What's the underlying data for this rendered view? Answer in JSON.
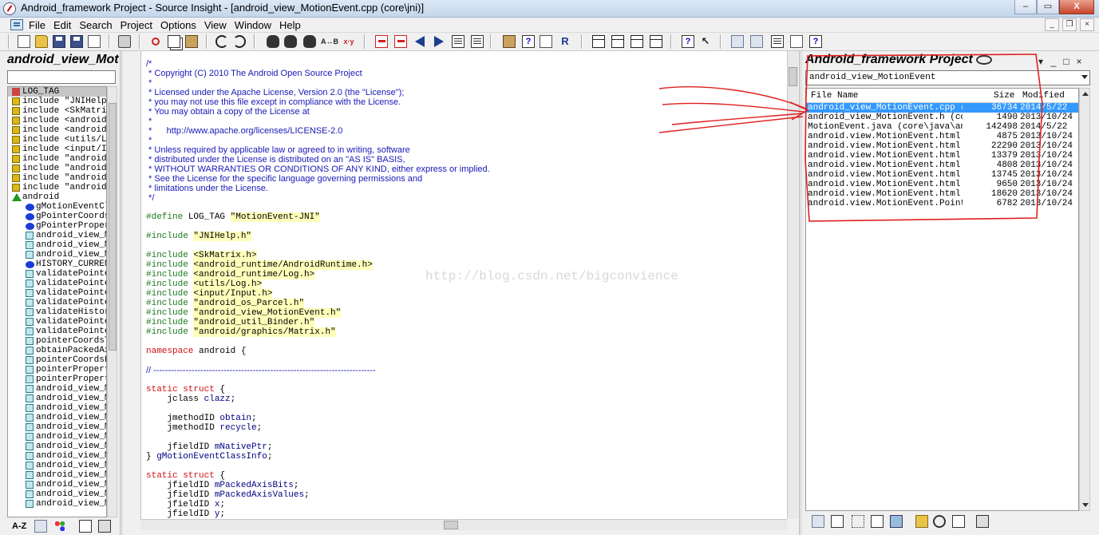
{
  "window": {
    "title": "Android_framework Project - Source Insight - [android_view_MotionEvent.cpp (core\\jni)]",
    "buttons": {
      "minimize": "–",
      "maximize": "▭",
      "close": "X"
    }
  },
  "menu": {
    "items": [
      "File",
      "Edit",
      "Search",
      "Project",
      "Options",
      "View",
      "Window",
      "Help"
    ],
    "mdi": {
      "minimize": "_",
      "restore": "❐",
      "close": "×"
    }
  },
  "toolbar": {
    "replace_label": "A↔B",
    "xy_label": "x·y"
  },
  "symbol_panel": {
    "title": "android_view_Motio",
    "items": [
      {
        "kind": "hash",
        "label": "LOG_TAG",
        "indent": false
      },
      {
        "kind": "inc",
        "label": "include \"JNIHelp.h\"",
        "indent": false
      },
      {
        "kind": "inc",
        "label": "include <SkMatrix.h>",
        "indent": false
      },
      {
        "kind": "inc",
        "label": "include <android_runtime>",
        "indent": false
      },
      {
        "kind": "inc",
        "label": "include <android_runtime>",
        "indent": false
      },
      {
        "kind": "inc",
        "label": "include <utils/Log.h>",
        "indent": false
      },
      {
        "kind": "inc",
        "label": "include <input/Input.h>",
        "indent": false
      },
      {
        "kind": "inc",
        "label": "include \"android_os\"",
        "indent": false
      },
      {
        "kind": "inc",
        "label": "include \"android_view\"",
        "indent": false
      },
      {
        "kind": "inc",
        "label": "include \"android_util\"",
        "indent": false
      },
      {
        "kind": "inc",
        "label": "include \"android/gr\"",
        "indent": false
      },
      {
        "kind": "tri",
        "label": "android",
        "indent": false
      },
      {
        "kind": "var",
        "label": "gMotionEventClassInfo",
        "indent": true
      },
      {
        "kind": "var",
        "label": "gPointerCoordsClassInfo",
        "indent": true
      },
      {
        "kind": "var",
        "label": "gPointerPropertiesClassInfo",
        "indent": true
      },
      {
        "kind": "fn",
        "label": "android_view_MotionEvent",
        "indent": true
      },
      {
        "kind": "fn",
        "label": "android_view_MotionEvent",
        "indent": true
      },
      {
        "kind": "fn",
        "label": "android_view_MotionEvent",
        "indent": true
      },
      {
        "kind": "var",
        "label": "HISTORY_CURRENT",
        "indent": true
      },
      {
        "kind": "fn",
        "label": "validatePointerCount",
        "indent": true
      },
      {
        "kind": "fn",
        "label": "validatePointerIndex",
        "indent": true
      },
      {
        "kind": "fn",
        "label": "validatePointerCoords",
        "indent": true
      },
      {
        "kind": "fn",
        "label": "validatePointerProps",
        "indent": true
      },
      {
        "kind": "fn",
        "label": "validateHistoryPos",
        "indent": true
      },
      {
        "kind": "fn",
        "label": "validatePointerIds",
        "indent": true
      },
      {
        "kind": "fn",
        "label": "validatePointerCoordsObj",
        "indent": true
      },
      {
        "kind": "fn",
        "label": "pointerCoordsToNative",
        "indent": true
      },
      {
        "kind": "fn",
        "label": "obtainPackedAxisValues",
        "indent": true
      },
      {
        "kind": "fn",
        "label": "pointerCoordsFromNative",
        "indent": true
      },
      {
        "kind": "fn",
        "label": "pointerPropertiesToNative",
        "indent": true
      },
      {
        "kind": "fn",
        "label": "pointerPropertiesFromNative",
        "indent": true
      },
      {
        "kind": "fn",
        "label": "android_view_MotionEvent",
        "indent": true
      },
      {
        "kind": "fn",
        "label": "android_view_MotionEvent",
        "indent": true
      },
      {
        "kind": "fn",
        "label": "android_view_MotionEvent",
        "indent": true
      },
      {
        "kind": "fn",
        "label": "android_view_MotionEvent",
        "indent": true
      },
      {
        "kind": "fn",
        "label": "android_view_MotionEvent",
        "indent": true
      },
      {
        "kind": "fn",
        "label": "android_view_MotionEvent",
        "indent": true
      },
      {
        "kind": "fn",
        "label": "android_view_MotionEvent",
        "indent": true
      },
      {
        "kind": "fn",
        "label": "android_view_MotionEvent",
        "indent": true
      },
      {
        "kind": "fn",
        "label": "android_view_MotionEvent",
        "indent": true
      },
      {
        "kind": "fn",
        "label": "android_view_MotionEvent",
        "indent": true
      },
      {
        "kind": "fn",
        "label": "android_view_MotionEvent",
        "indent": true
      },
      {
        "kind": "fn",
        "label": "android_view_MotionEvent",
        "indent": true
      },
      {
        "kind": "fn",
        "label": "android_view_MotionEvent",
        "indent": true
      }
    ],
    "tabs": {
      "sort_label": "A-Z"
    }
  },
  "editor": {
    "file": "android_view_MotionEvent.cpp",
    "watermark": "http://blog.csdn.net/bigconvience",
    "lines": [
      [
        [
          "cm",
          "/*"
        ]
      ],
      [
        [
          "cm",
          " * Copyright (C) 2010 The Android Open Source Project"
        ]
      ],
      [
        [
          "cm",
          " *"
        ]
      ],
      [
        [
          "cm",
          " * Licensed under the Apache License, Version 2.0 (the \"License\");"
        ]
      ],
      [
        [
          "cm",
          " * you may not use this file except in compliance with the License."
        ]
      ],
      [
        [
          "cm",
          " * You may obtain a copy of the License at"
        ]
      ],
      [
        [
          "cm",
          " *"
        ]
      ],
      [
        [
          "cm",
          " *      http://www.apache.org/licenses/LICENSE-2.0"
        ]
      ],
      [
        [
          "cm",
          " *"
        ]
      ],
      [
        [
          "cm",
          " * Unless required by applicable law or agreed to in writing, software"
        ]
      ],
      [
        [
          "cm",
          " * distributed under the License is distributed on an \"AS IS\" BASIS,"
        ]
      ],
      [
        [
          "cm",
          " * WITHOUT WARRANTIES OR CONDITIONS OF ANY KIND, either express or implied."
        ]
      ],
      [
        [
          "cm",
          " * See the License for the specific language governing permissions and"
        ]
      ],
      [
        [
          "cm",
          " * limitations under the License."
        ]
      ],
      [
        [
          "cm",
          " */"
        ]
      ],
      [],
      [
        [
          "pp",
          "#define "
        ],
        [
          "",
          "LOG_TAG "
        ],
        [
          "str",
          "\"MotionEvent-JNI\""
        ]
      ],
      [],
      [
        [
          "pp",
          "#include "
        ],
        [
          "str",
          "\"JNIHelp.h\""
        ]
      ],
      [],
      [
        [
          "pp",
          "#include "
        ],
        [
          "str",
          "<SkMatrix.h>"
        ]
      ],
      [
        [
          "pp",
          "#include "
        ],
        [
          "str",
          "<android_runtime/AndroidRuntime.h>"
        ]
      ],
      [
        [
          "pp",
          "#include "
        ],
        [
          "str",
          "<android_runtime/Log.h>"
        ]
      ],
      [
        [
          "pp",
          "#include "
        ],
        [
          "str",
          "<utils/Log.h>"
        ]
      ],
      [
        [
          "pp",
          "#include "
        ],
        [
          "str",
          "<input/Input.h>"
        ]
      ],
      [
        [
          "pp",
          "#include "
        ],
        [
          "str",
          "\"android_os_Parcel.h\""
        ]
      ],
      [
        [
          "pp",
          "#include "
        ],
        [
          "str",
          "\"android_view_MotionEvent.h\""
        ]
      ],
      [
        [
          "pp",
          "#include "
        ],
        [
          "str",
          "\"android_util_Binder.h\""
        ]
      ],
      [
        [
          "pp",
          "#include "
        ],
        [
          "str",
          "\"android/graphics/Matrix.h\""
        ]
      ],
      [],
      [
        [
          "kw",
          "namespace "
        ],
        [
          "",
          "android {"
        ]
      ],
      [],
      [
        [
          "cm",
          "// ----------------------------------------------------------------------------"
        ]
      ],
      [],
      [
        [
          "kw",
          "static struct "
        ],
        [
          "",
          "{"
        ]
      ],
      [
        [
          "",
          "    jclass "
        ],
        [
          "id",
          "clazz"
        ],
        [
          "",
          ";"
        ]
      ],
      [],
      [
        [
          "",
          "    jmethodID "
        ],
        [
          "id",
          "obtain"
        ],
        [
          "",
          ";"
        ]
      ],
      [
        [
          "",
          "    jmethodID "
        ],
        [
          "id",
          "recycle"
        ],
        [
          "",
          ";"
        ]
      ],
      [],
      [
        [
          "",
          "    jfieldID "
        ],
        [
          "id",
          "mNativePtr"
        ],
        [
          "",
          ";"
        ]
      ],
      [
        [
          "",
          "} "
        ],
        [
          "id",
          "gMotionEventClassInfo"
        ],
        [
          "",
          ";"
        ]
      ],
      [],
      [
        [
          "kw",
          "static struct "
        ],
        [
          "",
          "{"
        ]
      ],
      [
        [
          "",
          "    jfieldID "
        ],
        [
          "id",
          "mPackedAxisBits"
        ],
        [
          "",
          ";"
        ]
      ],
      [
        [
          "",
          "    jfieldID "
        ],
        [
          "id",
          "mPackedAxisValues"
        ],
        [
          "",
          ";"
        ]
      ],
      [
        [
          "",
          "    jfieldID "
        ],
        [
          "id",
          "x"
        ],
        [
          "",
          ";"
        ]
      ],
      [
        [
          "",
          "    jfieldID "
        ],
        [
          "id",
          "y"
        ],
        [
          "",
          ";"
        ]
      ]
    ]
  },
  "project_panel": {
    "title": "Android_framework Project",
    "controls": {
      "pin": "▾",
      "minimize": "_",
      "restore": "□",
      "close": "×"
    },
    "filter_value": "android_view_MotionEvent",
    "columns": {
      "name": "File Name",
      "size": "Size",
      "modified": "Modified"
    },
    "files": [
      {
        "name": "android_view_MotionEvent.cpp (co",
        "size": "36734",
        "modified": "2014/5/22",
        "selected": true
      },
      {
        "name": "android_view_MotionEvent.h (core",
        "size": "1490",
        "modified": "2013/10/24",
        "selected": false
      },
      {
        "name": "MotionEvent.java (core\\java\\andr",
        "size": "142498",
        "modified": "2014/5/22",
        "selected": false
      },
      {
        "name": "android.view.MotionEvent.html (d",
        "size": "4875",
        "modified": "2013/10/24",
        "selected": false
      },
      {
        "name": "android.view.MotionEvent.html (d",
        "size": "22290",
        "modified": "2013/10/24",
        "selected": false
      },
      {
        "name": "android.view.MotionEvent.html (d",
        "size": "13379",
        "modified": "2013/10/24",
        "selected": false
      },
      {
        "name": "android.view.MotionEvent.html (d",
        "size": "4808",
        "modified": "2013/10/24",
        "selected": false
      },
      {
        "name": "android.view.MotionEvent.html (d",
        "size": "13745",
        "modified": "2013/10/24",
        "selected": false
      },
      {
        "name": "android.view.MotionEvent.html (d",
        "size": "9650",
        "modified": "2013/10/24",
        "selected": false
      },
      {
        "name": "android.view.MotionEvent.html (d",
        "size": "18620",
        "modified": "2013/10/24",
        "selected": false
      },
      {
        "name": "android.view.MotionEvent.Pointer",
        "size": "6782",
        "modified": "2013/10/24",
        "selected": false
      }
    ]
  },
  "colors": {
    "comment": "#1818b8",
    "preprocessor": "#1a7a1a",
    "keyword": "#d01010",
    "selection": "#3399ff",
    "annotation": "#e02020"
  }
}
